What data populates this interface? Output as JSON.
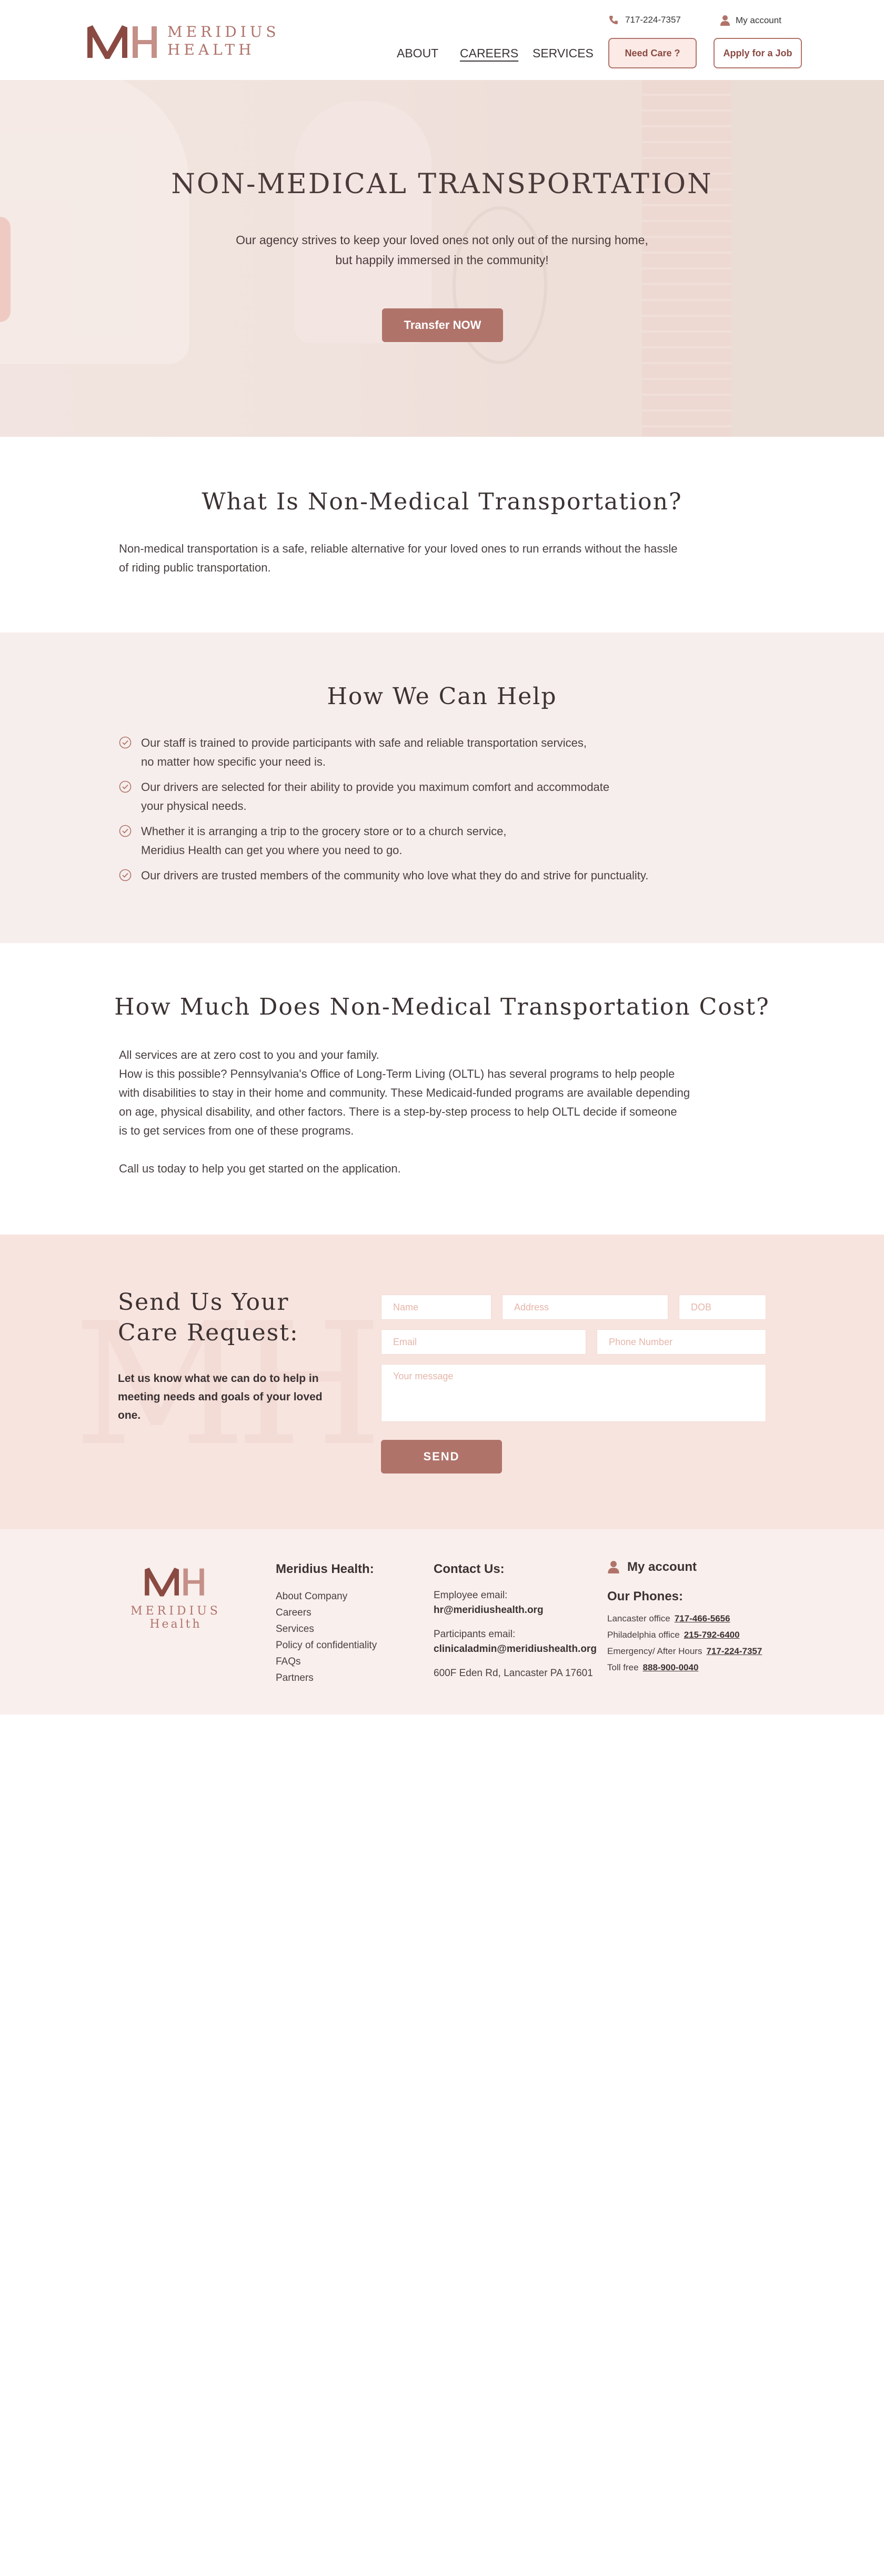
{
  "header": {
    "logo_text_line1": "MERIDIUS",
    "logo_text_line2": "HEALTH",
    "phone": "717-224-7357",
    "account": "My account",
    "nav": [
      "ABOUT",
      "CAREERS",
      "SERVICES"
    ],
    "need_care": "Need Care ?",
    "apply_job": "Apply for a Job"
  },
  "hero": {
    "title": "NON-MEDICAL TRANSPORTATION",
    "subtitle_line1": "Our agency strives to keep your loved ones not only out of the nursing home,",
    "subtitle_line2": "but happily immersed in the community!",
    "button": "Transfer NOW"
  },
  "what": {
    "title": "What Is Non-Medical Transportation?",
    "line1": "Non-medical transportation is a safe, reliable alternative for your loved ones to run errands without the hassle",
    "line2": "of riding public transportation."
  },
  "help": {
    "title": "How We Can Help",
    "items": [
      {
        "l1": "Our staff is trained to provide participants with safe and reliable transportation services,",
        "l2": "no matter how specific your need is."
      },
      {
        "l1": "Our drivers are selected for their ability to provide you maximum comfort and accommodate",
        "l2": "your physical needs."
      },
      {
        "l1": "Whether it is arranging a trip to the grocery store or to a church service,",
        "l2": "Meridius Health can get you where you need to go."
      },
      {
        "l1": "Our drivers are trusted members of the community who love what they do and strive for punctuality.",
        "l2": ""
      }
    ]
  },
  "cost": {
    "title": "How Much Does Non-Medical Transportation Cost?",
    "lines": [
      "All services are at zero cost to you and your family.",
      "How is this possible? Pennsylvania's Office of Long-Term Living (OLTL) has several programs to help people",
      "with disabilities to stay in their home and community. These Medicaid-funded programs are available depending",
      "on age, physical disability, and other factors.  There is a step-by-step process to help OLTL decide if someone",
      "is to get services from one of these programs."
    ],
    "call": "Call us today to help you get started on the application."
  },
  "request": {
    "title_line1": "Send Us Your",
    "title_line2": "Care Request:",
    "sub": "Let us know what we can do to help in meeting needs and goals of your loved one.",
    "placeholders": {
      "name": "Name",
      "address": "Address",
      "dob": "DOB",
      "email": "Email",
      "phone": "Phone Number",
      "message": "Your message"
    },
    "send": "SEND"
  },
  "footer": {
    "logo_line1": "MERIDIUS",
    "logo_line2": "Health",
    "company_head": "Meridius Health:",
    "links": [
      "About Company",
      "Careers",
      "Services",
      "Policy of confidentiality",
      "FAQs",
      "Partners"
    ],
    "contact_head": "Contact Us:",
    "employee_label": "Employee email:",
    "employee_email": "hr@meridiushealth.org",
    "participants_label": "Participants email:",
    "participants_email": "clinicaladmin@meridiushealth.org",
    "address": "600F Eden Rd, Lancaster PA 17601",
    "account": "My account",
    "phones_head": "Our Phones:",
    "phones": [
      {
        "label": "Lancaster office",
        "num": "717-466-5656"
      },
      {
        "label": "Philadelphia office",
        "num": "215-792-6400"
      },
      {
        "label": "Emergency/ After Hours",
        "num": "717-224-7357"
      },
      {
        "label": "Toll free",
        "num": "888-900-0040"
      }
    ]
  },
  "colors": {
    "accent": "#b0736a",
    "light_bg": "#f6eeec",
    "request_bg": "#f8e4df"
  }
}
